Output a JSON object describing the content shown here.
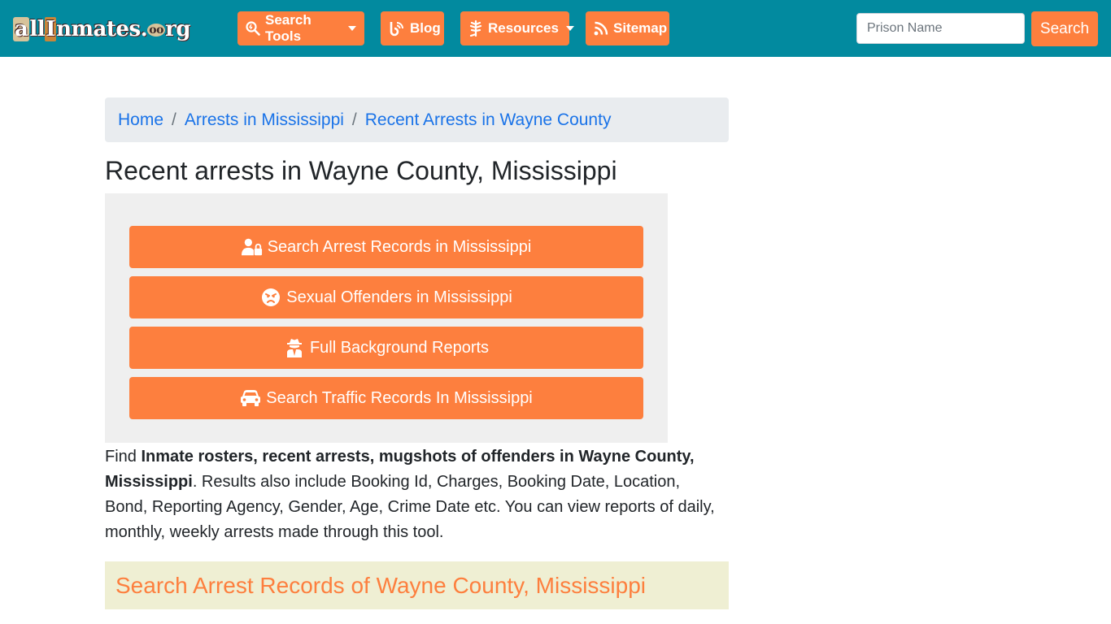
{
  "header": {
    "logo_text": {
      "a": "a",
      "ll": "ll",
      "i": "I",
      "nmates": "nmates.",
      "o": "oo",
      "rg": "rg"
    },
    "nav": [
      {
        "label": "Search Tools",
        "icon": "search-tools-icon",
        "dropdown": true
      },
      {
        "label": "Blog",
        "icon": "blog-icon",
        "dropdown": false
      },
      {
        "label": "Resources",
        "icon": "leaf-icon",
        "dropdown": true
      },
      {
        "label": "Sitemap",
        "icon": "rss-icon",
        "dropdown": false
      }
    ],
    "search": {
      "placeholder": "Prison Name",
      "value": "",
      "button_label": "Search"
    }
  },
  "breadcrumb": [
    {
      "label": "Home"
    },
    {
      "label": "Arrests in Mississippi"
    },
    {
      "label": "Recent Arrests in Wayne County"
    }
  ],
  "breadcrumb_separator": "/",
  "page_title": "Recent arrests in Wayne County, Mississippi",
  "actions": [
    {
      "label": "Search Arrest Records in Mississippi",
      "icon": "user-lock-icon"
    },
    {
      "label": "Sexual Offenders in Mississippi",
      "icon": "angry-face-icon"
    },
    {
      "label": "Full Background Reports",
      "icon": "user-secret-icon"
    },
    {
      "label": "Search Traffic Records In Mississippi",
      "icon": "car-icon"
    }
  ],
  "description": {
    "prefix": "Find ",
    "bold": "Inmate rosters, recent arrests, mugshots of offenders in Wayne County, Mississippi",
    "suffix": ". Results also include Booking Id, Charges, Booking Date, Location, Bond, Reporting Agency, Gender, Age, Crime Date etc. You can view reports of daily, monthly, weekly arrests made through this tool."
  },
  "section_heading": "Search Arrest Records of Wayne County, Mississippi",
  "colors": {
    "navbar": "#028a9f",
    "accent": "#fd7f3e",
    "link": "#1a73e8",
    "breadcrumb_bg": "#e9ecef",
    "panel_bg": "#efefef",
    "section_bg": "#efefd3"
  }
}
